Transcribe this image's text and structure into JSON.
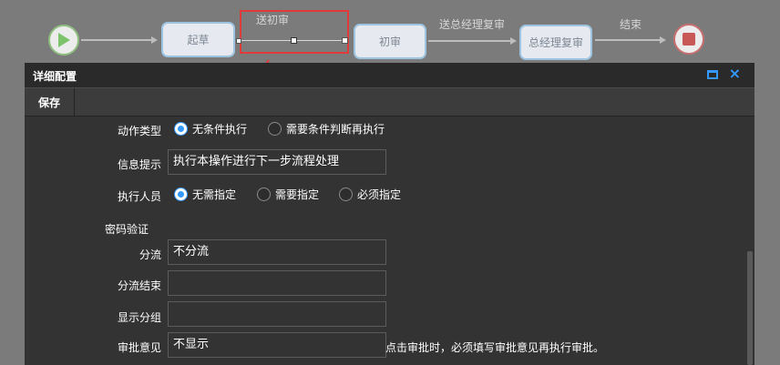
{
  "workflow": {
    "nodes": {
      "start": {
        "label": "起草"
      },
      "first_review": {
        "label": "初审"
      },
      "gm_review": {
        "label": "总经理复审"
      }
    },
    "transitions": {
      "to_first_review": "送初审",
      "to_gm_review": "送总经理复审",
      "finish": "结束"
    },
    "start_icon_color": "#7cc36b",
    "stop_icon_color": "#c85757"
  },
  "dialog": {
    "title": "详细配置",
    "toolbar": {
      "save_label": "保存"
    },
    "form": {
      "action_type": {
        "label": "动作类型",
        "options": [
          "无条件执行",
          "需要条件判断再执行"
        ],
        "selected": "无条件执行"
      },
      "message": {
        "label": "信息提示",
        "value": "执行本操作进行下一步流程处理"
      },
      "executor": {
        "label": "执行人员",
        "options": [
          "无需指定",
          "需要指定",
          "必须指定"
        ],
        "selected": "无需指定"
      },
      "password_verify": {
        "label": "密码验证"
      },
      "branch": {
        "label": "分流",
        "value": "不分流"
      },
      "branch_end": {
        "label": "分流结束",
        "value": ""
      },
      "display_group": {
        "label": "显示分组",
        "value": ""
      },
      "approval_opinion": {
        "label": "审批意见",
        "value": "不显示",
        "hint": "点击审批时，必须填写审批意见再执行审批。"
      }
    }
  },
  "colors": {
    "accent": "#3399ff",
    "highlight": "#e03a3a",
    "canvas_bg": "#7b7b7b",
    "dialog_bg": "#333333"
  }
}
